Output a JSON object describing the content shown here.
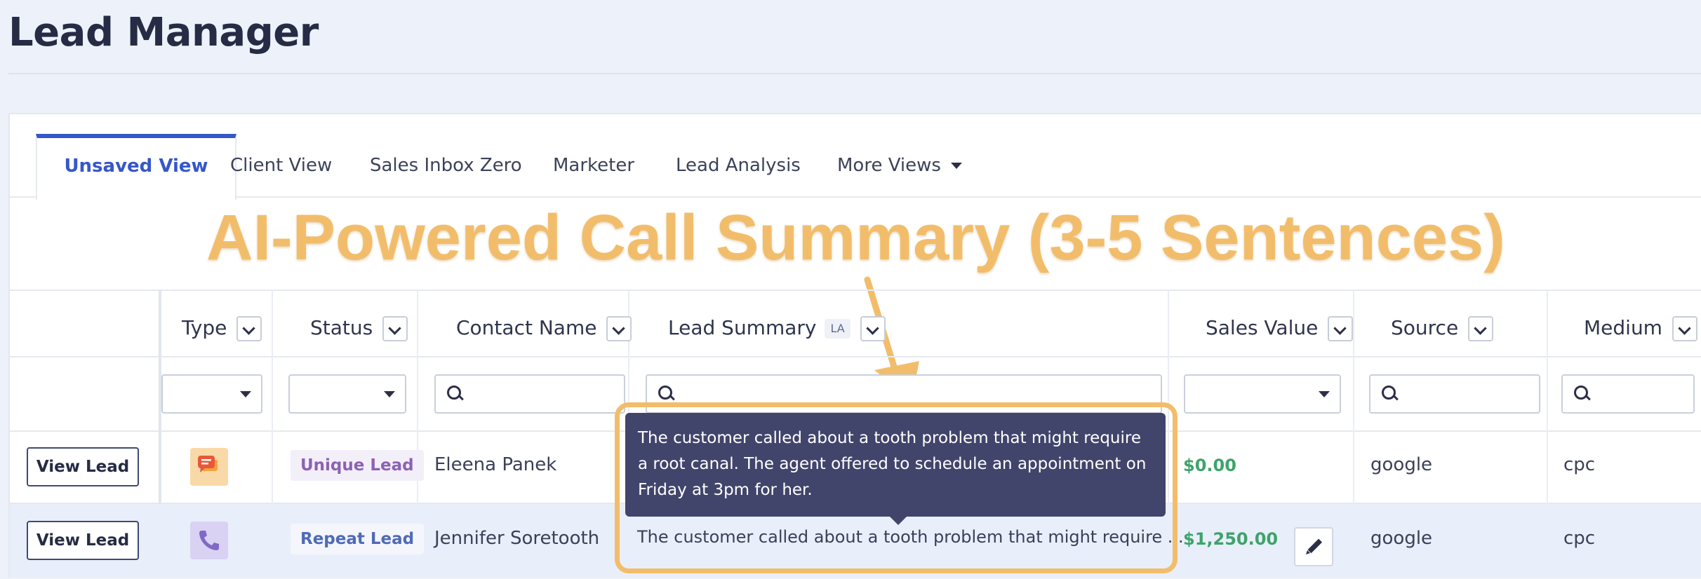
{
  "page": {
    "title": "Lead Manager"
  },
  "tabs": [
    {
      "label": "Unsaved View",
      "active": true
    },
    {
      "label": "Client View"
    },
    {
      "label": "Sales Inbox Zero"
    },
    {
      "label": "Marketer"
    },
    {
      "label": "Lead Analysis"
    },
    {
      "label": "More Views"
    }
  ],
  "banner": {
    "text": "AI-Powered Call Summary (3-5 Sentences)"
  },
  "columns": {
    "type": "Type",
    "status": "Status",
    "contact_name": "Contact Name",
    "lead_summary": "Lead Summary",
    "lead_summary_badge": "LA",
    "sales_value": "Sales Value",
    "source": "Source",
    "medium": "Medium"
  },
  "rows": [
    {
      "action": "View Lead",
      "type_icon": "chat-icon",
      "status": "Unique Lead",
      "contact_name": "Eleena Panek",
      "sales_value": "$0.00",
      "source": "google",
      "medium": "cpc"
    },
    {
      "action": "View Lead",
      "type_icon": "phone-icon",
      "status": "Repeat Lead",
      "contact_name": "Jennifer Soretooth",
      "lead_summary": "The customer called about a tooth problem that might require ...",
      "sales_value": "$1,250.00",
      "source": "google",
      "medium": "cpc"
    }
  ],
  "tooltip": {
    "text": "The customer called about a tooth problem that might require a root canal. The agent offered to schedule an appointment on Friday at 3pm for her."
  },
  "colors": {
    "accent": "#3557c9",
    "annotation": "#f2bd6b",
    "money": "#3ea36a",
    "tooltip_bg": "#41456b"
  }
}
